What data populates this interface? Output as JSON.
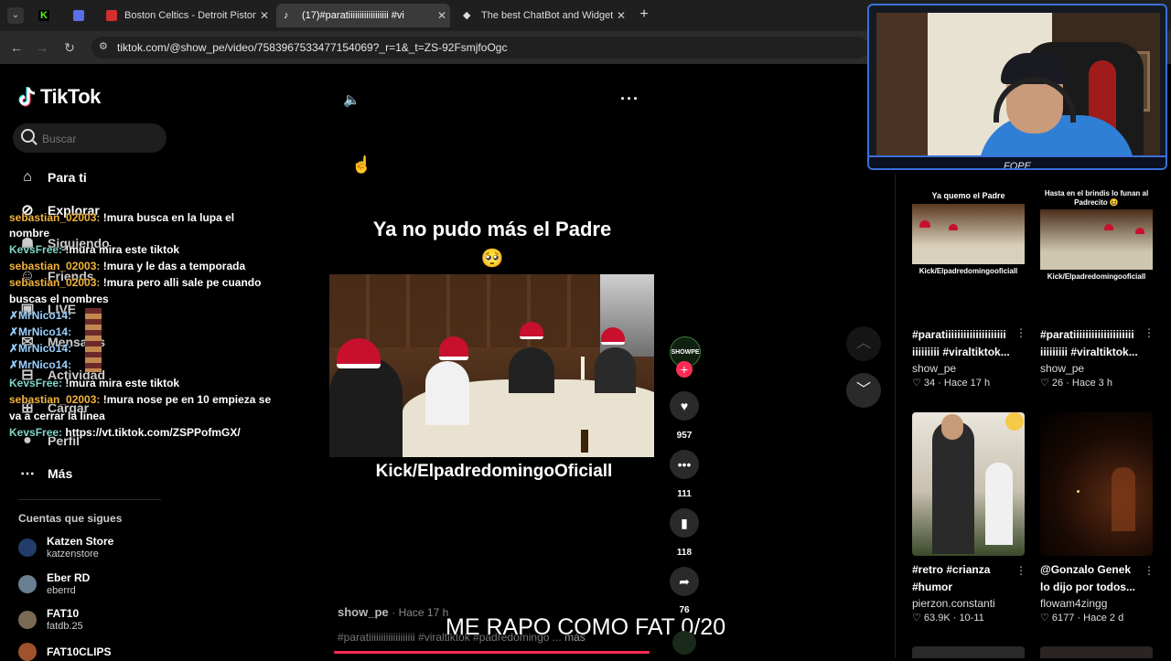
{
  "tabs": [
    {
      "title": "",
      "icon": "kick-icon",
      "color": "#53fc18"
    },
    {
      "title": "",
      "icon": "app-icon",
      "color": "#5b6fe8"
    },
    {
      "title": "Boston Celtics - Detroit Pistons",
      "icon": "espn-icon",
      "color": "#d32f2f"
    },
    {
      "title": "(17)#paratiiiiiiiiiiiiiiiiii #vi",
      "icon": "tiktok-icon",
      "color": "#ffffff"
    },
    {
      "title": "The best ChatBot and Widgets",
      "icon": "bot-icon",
      "color": "#ffffff"
    }
  ],
  "url": "tiktok.com/@show_pe/video/7583967533477154069?_r=1&_t=ZS-92FsmjfoOgc",
  "logo": "TikTok",
  "search_placeholder": "Buscar",
  "nav": [
    {
      "label": "Para ti",
      "icon": "home-icon"
    },
    {
      "label": "Explorar",
      "icon": "compass-icon"
    },
    {
      "label": "Siguiendo",
      "icon": "people-icon"
    },
    {
      "label": "Friends",
      "icon": "friends-icon"
    },
    {
      "label": "LIVE",
      "icon": "live-icon"
    },
    {
      "label": "Mensajes",
      "icon": "message-icon"
    },
    {
      "label": "Actividad",
      "icon": "bell-icon"
    },
    {
      "label": "Cargar",
      "icon": "upload-icon"
    },
    {
      "label": "Perfil",
      "icon": "profile-icon"
    },
    {
      "label": "Más",
      "icon": "more-icon"
    }
  ],
  "following_title": "Cuentas que sigues",
  "following": [
    {
      "name": "Katzen Store",
      "handle": "katzenstore",
      "color": "#223c6b"
    },
    {
      "name": "Eber RD",
      "handle": "eberrd",
      "color": "#6a7f92"
    },
    {
      "name": "FAT10",
      "handle": "fatdb.25",
      "color": "#7a6a55"
    },
    {
      "name": "FAT10CLIPS",
      "handle": "",
      "color": "#a0522d"
    }
  ],
  "chat": [
    {
      "user": "sebastian_02003:",
      "text": " !mura busca en la lupa el",
      "ucolor": "u1"
    },
    {
      "user": "",
      "text": "nombre",
      "ucolor": "u1"
    },
    {
      "user": "KevsFree:",
      "text": " !mura mira este tiktok",
      "ucolor": "u2"
    },
    {
      "user": "sebastian_02003:",
      "text": " !mura y le das a temporada",
      "ucolor": "u1"
    },
    {
      "user": "sebastian_02003:",
      "text": " !mura pero alli sale pe cuando",
      "ucolor": "u1"
    },
    {
      "user": "",
      "text": "buscas el nombres",
      "ucolor": "u1"
    },
    {
      "user": "✗MrNico14:",
      "text": "",
      "ucolor": "u3"
    },
    {
      "user": "✗MrNico14:",
      "text": "",
      "ucolor": "u3"
    },
    {
      "user": "✗MrNico14:",
      "text": "",
      "ucolor": "u3"
    },
    {
      "user": "✗MrNico14:",
      "text": "",
      "ucolor": "u3"
    },
    {
      "user": "KevsFree:",
      "text": " !mura mira este tiktok",
      "ucolor": "u2"
    },
    {
      "user": "sebastian_02003:",
      "text": " !mura nose pe en 10 empieza se",
      "ucolor": "u1"
    },
    {
      "user": "",
      "text": "va a cerrar la linea",
      "ucolor": "u1"
    },
    {
      "user": "KevsFree:",
      "text": " https://vt.tiktok.com/ZSPPofmGX/",
      "ucolor": "u2"
    }
  ],
  "video": {
    "title": "Ya no pudo más el Padre",
    "emoji": "🥺",
    "watermark": "Kick/ElpadredomingoOficiall",
    "author": "show_pe",
    "time": "· Hace 17 h",
    "desc": "#paratiiiiiiiiiiiiiiiiiii #viraltiktok #padredomingo ...",
    "more": "más",
    "avatar_text": "SHOWPE"
  },
  "actions": {
    "likes": "957",
    "comments": "111",
    "saves": "118",
    "shares": "76"
  },
  "overlay_text": "ME RAPO COMO FAT 0/20",
  "webcam_name": "FOPE",
  "grid": [
    {
      "overlay": "Ya quemo el Padre",
      "overlay2": "Kick/Elpadredomingooficiall",
      "caption1": "#paratiiiiiiiiiiiiiiiiiiii",
      "caption2": "iiiiiiiii #viraltiktok...",
      "author": "show_pe",
      "stats": "♡ 34 · Hace 17 h"
    },
    {
      "overlay": "Hasta en el brindis lo funan al Padrecito 😆",
      "overlay2": "Kick/Elpadredomingooficiall",
      "caption1": "#paratiiiiiiiiiiiiiiiiiiii",
      "caption2": "iiiiiiiii #viraltiktok...",
      "author": "show_pe",
      "stats": "♡ 26 · Hace 3 h"
    },
    {
      "overlay": "",
      "overlay2": "",
      "caption1": "#retro #crianza",
      "caption2": "#humor",
      "author": "pierzon.constanti",
      "stats": "♡ 63.9K · 10-11"
    },
    {
      "overlay": "",
      "overlay2": "",
      "caption1": "@Gonzalo Genek",
      "caption2": "lo dijo por todos...",
      "author": "flowam4zingg",
      "stats": "♡ 6177 · Hace 2 d"
    }
  ]
}
